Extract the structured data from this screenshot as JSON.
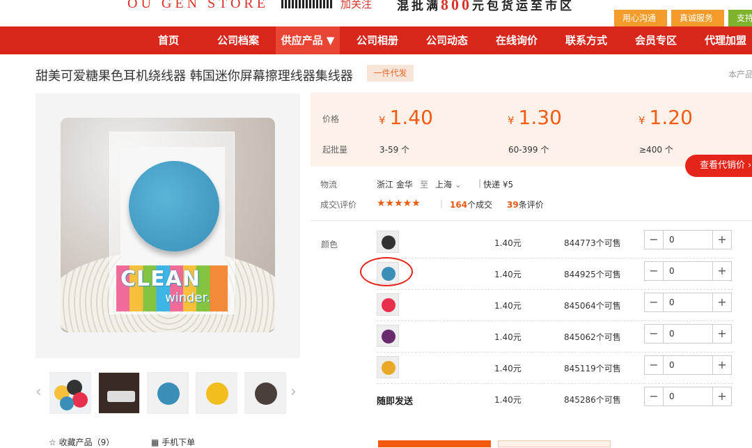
{
  "header": {
    "store_name": "OU GEN STORE",
    "follow_label": "加关注",
    "promo_prefix": "混批满",
    "promo_amount": "800",
    "promo_suffix": "元包货运至市区",
    "tabs": [
      "用心沟通",
      "真诚服务",
      "支持"
    ]
  },
  "nav": {
    "items": [
      "首页",
      "公司档案",
      "供应产品 ▼",
      "公司相册",
      "公司动态",
      "在线询价",
      "联系方式",
      "会员专区",
      "代理加盟"
    ],
    "active_index": 2
  },
  "product": {
    "title": "甜美可爱糖果色耳机绕线器 韩国迷你屏幕擦理线器集线器",
    "tag": "一件代发",
    "right_note": "本产品",
    "image_text_1": "CLEAN",
    "image_text_2": "winder."
  },
  "pricing": {
    "price_label": "价格",
    "moq_label": "起批量",
    "currency": "¥",
    "tiers": [
      {
        "price": "1.40",
        "range": "3-59 个"
      },
      {
        "price": "1.30",
        "range": "60-399 个"
      },
      {
        "price": "1.20",
        "range": "≥400 个"
      }
    ],
    "agent_button": "查看代销价 ›"
  },
  "logistics": {
    "label": "物流",
    "from": "浙江 金华",
    "to_word": "至",
    "to": "上海",
    "express": "快递 ¥5"
  },
  "reviews": {
    "label": "成交\\评价",
    "stars": "★★★★★",
    "rating": 4.5,
    "deals_count": "164",
    "deals_label": "个成交",
    "reviews_count": "39",
    "reviews_label": "条评价"
  },
  "sku": {
    "color_label": "颜色",
    "rows": [
      {
        "name": "",
        "swatch": "#333333",
        "price": "1.40元",
        "stock": "844773个可售",
        "qty": "0"
      },
      {
        "name": "",
        "swatch": "#3a8fb8",
        "price": "1.40元",
        "stock": "844925个可售",
        "qty": "0"
      },
      {
        "name": "",
        "swatch": "#e8304d",
        "price": "1.40元",
        "stock": "845064个可售",
        "qty": "0"
      },
      {
        "name": "",
        "swatch": "#6a2a6e",
        "price": "1.40元",
        "stock": "845062个可售",
        "qty": "0"
      },
      {
        "name": "",
        "swatch": "#e9a826",
        "price": "1.40元",
        "stock": "845119个可售",
        "qty": "0"
      },
      {
        "name": "随即发送",
        "swatch": "",
        "price": "1.40元",
        "stock": "845286个可售",
        "qty": "0"
      }
    ],
    "minus": "−",
    "plus": "+"
  },
  "footer": {
    "favorite": "收藏产品（9）",
    "mobile_order": "手机下单"
  },
  "thumbnails": [
    "multi-color",
    "in-use",
    "blue",
    "yellow",
    "black"
  ]
}
